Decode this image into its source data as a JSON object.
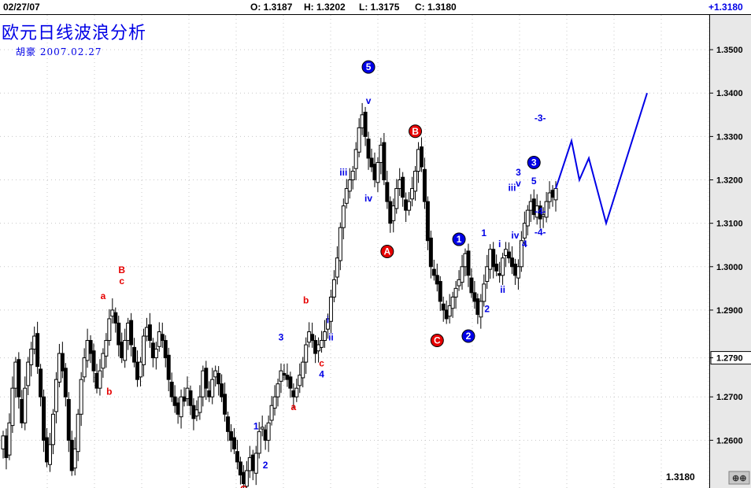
{
  "header": {
    "date": "02/27/07",
    "open": "O: 1.3187",
    "high": "H: 1.3202",
    "low": "L: 1.3175",
    "close": "C: 1.3180",
    "change": "+1.3180"
  },
  "title": "欧元日线波浪分析",
  "subtitle": "胡豪  2007.02.27",
  "last_price_label": "1.3180",
  "colors": {
    "blue": "#0000e6",
    "red": "#e60000",
    "grid": "#c8c8c8",
    "candle": "#000000"
  },
  "chart_data": {
    "type": "candlestick",
    "ylim": [
      1.249,
      1.358
    ],
    "yticks": [
      "1.3500",
      "1.3400",
      "1.3300",
      "1.3200",
      "1.3100",
      "1.3000",
      "1.2900",
      "1.2790",
      "1.2700",
      "1.2600"
    ],
    "ytick_values": [
      1.35,
      1.34,
      1.33,
      1.32,
      1.31,
      1.3,
      1.29,
      1.279,
      1.27,
      1.26
    ],
    "highlighted_price": "1.2790",
    "closes": [
      1.261,
      1.256,
      1.264,
      1.272,
      1.278,
      1.27,
      1.264,
      1.272,
      1.278,
      1.281,
      1.284,
      1.277,
      1.27,
      1.26,
      1.255,
      1.259,
      1.266,
      1.274,
      1.28,
      1.276,
      1.27,
      1.26,
      1.253,
      1.258,
      1.266,
      1.274,
      1.279,
      1.283,
      1.28,
      1.276,
      1.272,
      1.276,
      1.28,
      1.283,
      1.288,
      1.29,
      1.287,
      1.282,
      1.279,
      1.283,
      1.287,
      1.282,
      1.278,
      1.274,
      1.278,
      1.284,
      1.286,
      1.283,
      1.279,
      1.281,
      1.285,
      1.283,
      1.279,
      1.274,
      1.27,
      1.268,
      1.266,
      1.27,
      1.269,
      1.272,
      1.268,
      1.265,
      1.267,
      1.27,
      1.276,
      1.272,
      1.27,
      1.274,
      1.276,
      1.273,
      1.27,
      1.266,
      1.262,
      1.26,
      1.258,
      1.255,
      1.252,
      1.25,
      1.253,
      1.256,
      1.253,
      1.257,
      1.262,
      1.263,
      1.26,
      1.264,
      1.268,
      1.27,
      1.273,
      1.276,
      1.275,
      1.274,
      1.272,
      1.27,
      1.272,
      1.275,
      1.278,
      1.282,
      1.285,
      1.283,
      1.28,
      1.282,
      1.283,
      1.285,
      1.288,
      1.293,
      1.297,
      1.302,
      1.309,
      1.314,
      1.318,
      1.32,
      1.322,
      1.327,
      1.332,
      1.335,
      1.33,
      1.325,
      1.323,
      1.32,
      1.324,
      1.328,
      1.32,
      1.315,
      1.31,
      1.314,
      1.318,
      1.32,
      1.316,
      1.313,
      1.315,
      1.318,
      1.322,
      1.327,
      1.323,
      1.315,
      1.306,
      1.3,
      1.298,
      1.296,
      1.292,
      1.29,
      1.288,
      1.291,
      1.293,
      1.295,
      1.297,
      1.3,
      1.303,
      1.298,
      1.294,
      1.292,
      1.289,
      1.292,
      1.296,
      1.3,
      1.304,
      1.3,
      1.299,
      1.298,
      1.302,
      1.304,
      1.302,
      1.3,
      1.298,
      1.3,
      1.306,
      1.31,
      1.313,
      1.315,
      1.312,
      1.314,
      1.311,
      1.312,
      1.315,
      1.317,
      1.316,
      1.318
    ],
    "forecast": [
      1.318,
      1.329,
      1.32,
      1.325,
      1.31,
      1.34
    ],
    "annotations": [
      {
        "label": "a",
        "color": "red",
        "price": 1.2925,
        "bar": 32
      },
      {
        "label": "b",
        "color": "red",
        "price": 1.2705,
        "bar": 34
      },
      {
        "label": "B",
        "color": "red",
        "price": 1.2985,
        "bar": 38
      },
      {
        "label": "c",
        "color": "red",
        "price": 1.296,
        "bar": 38
      },
      {
        "label": "C",
        "color": "red",
        "price": 1.248,
        "bar": 77
      },
      {
        "label": "1",
        "color": "blue",
        "price": 1.2625,
        "bar": 81
      },
      {
        "label": "2",
        "color": "blue",
        "price": 1.2535,
        "bar": 84
      },
      {
        "label": "3",
        "color": "blue",
        "price": 1.283,
        "bar": 89
      },
      {
        "label": "a",
        "color": "red",
        "price": 1.267,
        "bar": 93
      },
      {
        "label": "b",
        "color": "red",
        "price": 1.2915,
        "bar": 97
      },
      {
        "label": "i",
        "color": "blue",
        "price": 1.287,
        "bar": 104
      },
      {
        "label": "ii",
        "color": "blue",
        "price": 1.283,
        "bar": 105
      },
      {
        "label": "c",
        "color": "red",
        "price": 1.277,
        "bar": 102
      },
      {
        "label": "4",
        "color": "blue",
        "price": 1.2745,
        "bar": 102
      },
      {
        "label": "iii",
        "color": "blue",
        "price": 1.321,
        "bar": 109
      },
      {
        "label": "v",
        "color": "blue",
        "price": 1.3375,
        "bar": 117
      },
      {
        "label": "5",
        "color": "blue",
        "price": 1.3445,
        "bar": 117
      },
      {
        "label": "iv",
        "color": "blue",
        "price": 1.315,
        "bar": 117
      },
      {
        "label": "B",
        "color": "red",
        "price": 1.3312,
        "bar": 132,
        "circled": true
      },
      {
        "label": "A",
        "color": "red",
        "price": 1.3035,
        "bar": 123,
        "circled": true
      },
      {
        "label": "C",
        "color": "red",
        "price": 1.283,
        "bar": 139,
        "circled": true
      },
      {
        "label": "1",
        "color": "blue",
        "price": 1.3063,
        "bar": 146,
        "circled": true
      },
      {
        "label": "2",
        "color": "blue",
        "price": 1.284,
        "bar": 149,
        "circled": true
      },
      {
        "label": "5",
        "color": "blue",
        "price": 1.346,
        "bar": 117,
        "circled": true
      },
      {
        "label": "1",
        "color": "blue",
        "price": 1.307,
        "bar": 154
      },
      {
        "label": "2",
        "color": "blue",
        "price": 1.2895,
        "bar": 155
      },
      {
        "label": "i",
        "color": "blue",
        "price": 1.3045,
        "bar": 159
      },
      {
        "label": "ii",
        "color": "blue",
        "price": 1.294,
        "bar": 160
      },
      {
        "label": "iii",
        "color": "blue",
        "price": 1.3175,
        "bar": 163
      },
      {
        "label": "iv",
        "color": "blue",
        "price": 1.3065,
        "bar": 164
      },
      {
        "label": "4",
        "color": "blue",
        "price": 1.3045,
        "bar": 167
      },
      {
        "label": "3",
        "color": "blue",
        "price": 1.321,
        "bar": 165
      },
      {
        "label": "v",
        "color": "blue",
        "price": 1.3185,
        "bar": 165
      },
      {
        "label": "5",
        "color": "blue",
        "price": 1.319,
        "bar": 170
      },
      {
        "label": "3",
        "color": "blue",
        "price": 1.324,
        "bar": 170,
        "circled": true
      },
      {
        "label": "-3-",
        "color": "blue",
        "price": 1.3335,
        "bar": 172
      },
      {
        "label": "-4-",
        "color": "blue",
        "price": 1.312,
        "bar": 172
      },
      {
        "label": "-4-",
        "color": "blue",
        "price": 1.3072,
        "bar": 172
      }
    ]
  }
}
